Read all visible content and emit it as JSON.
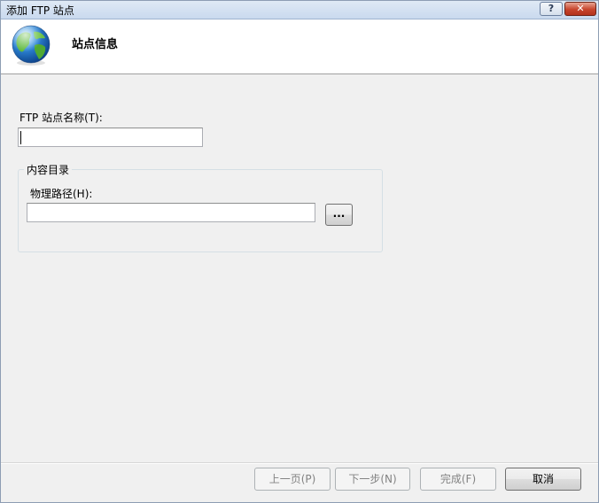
{
  "window": {
    "title": "添加 FTP 站点",
    "help_label": "?",
    "close_label": "✕"
  },
  "header": {
    "title": "站点信息",
    "icon": "globe-icon"
  },
  "form": {
    "site_name_label": "FTP 站点名称(T):",
    "site_name_value": "",
    "content_group_label": "内容目录",
    "physical_path_label": "物理路径(H):",
    "physical_path_value": "",
    "browse_label": "..."
  },
  "footer": {
    "prev_label": "上一页(P)",
    "next_label": "下一步(N)",
    "finish_label": "完成(F)",
    "cancel_label": "取消"
  },
  "colors": {
    "background": "#f0f0f0",
    "header_background": "#ffffff",
    "close_button": "#c7442c"
  }
}
